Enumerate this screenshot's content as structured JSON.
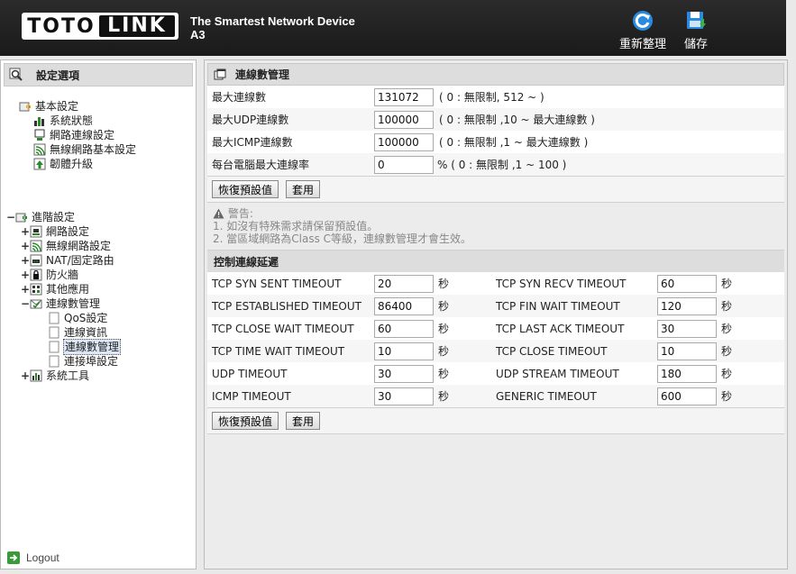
{
  "header": {
    "logo_left": "TOTO",
    "logo_right": "LINK",
    "tagline": "The Smartest Network Device",
    "model": "A3",
    "refresh_label": "重新整理",
    "save_label": "儲存"
  },
  "sidebar": {
    "title": "設定選項",
    "basic": {
      "label": "基本設定",
      "items": [
        "系統狀態",
        "網路連線設定",
        "無線網路基本設定",
        "韌體升級"
      ]
    },
    "advanced": {
      "label": "進階設定",
      "items": [
        "網路設定",
        "無線網路設定",
        "NAT/固定路由",
        "防火牆",
        "其他應用",
        "連線數管理",
        "系統工具"
      ],
      "conn_sub": [
        "QoS設定",
        "連線資訊",
        "連線數管理",
        "連接埠設定"
      ]
    },
    "logout": "Logout"
  },
  "main": {
    "title": "連線數管理",
    "settings": [
      {
        "label": "最大連線數",
        "value": "131072",
        "hint": "( 0 : 無限制, 512 ~ )"
      },
      {
        "label": "最大UDP連線數",
        "value": "100000",
        "hint": "( 0 : 無限制 ,10 ~ 最大連線數 )"
      },
      {
        "label": "最大ICMP連線數",
        "value": "100000",
        "hint": "( 0 : 無限制 ,1 ~ 最大連線數 )"
      },
      {
        "label": "每台電腦最大連線率",
        "value": "0",
        "hint": "% ( 0 : 無限制 ,1 ~ 100 )"
      }
    ],
    "btn_default": "恢復預設值",
    "btn_apply": "套用",
    "warning": {
      "title": "警告:",
      "line1": "1. 如沒有特殊需求請保留預設值。",
      "line2": "2. 當區域網路為Class C等級，連線數管理才會生效。"
    },
    "delay_title": "控制連線延遲",
    "unit": "秒",
    "timeouts": [
      {
        "l1": "TCP SYN SENT TIMEOUT",
        "v1": "20",
        "l2": "TCP SYN RECV TIMEOUT",
        "v2": "60"
      },
      {
        "l1": "TCP ESTABLISHED TIMEOUT",
        "v1": "86400",
        "l2": "TCP FIN WAIT TIMEOUT",
        "v2": "120"
      },
      {
        "l1": "TCP CLOSE WAIT TIMEOUT",
        "v1": "60",
        "l2": "TCP LAST ACK TIMEOUT",
        "v2": "30"
      },
      {
        "l1": "TCP TIME WAIT TIMEOUT",
        "v1": "10",
        "l2": "TCP CLOSE TIMEOUT",
        "v2": "10"
      },
      {
        "l1": "UDP TIMEOUT",
        "v1": "30",
        "l2": "UDP STREAM TIMEOUT",
        "v2": "180"
      },
      {
        "l1": "ICMP TIMEOUT",
        "v1": "30",
        "l2": "GENERIC TIMEOUT",
        "v2": "600"
      }
    ]
  }
}
